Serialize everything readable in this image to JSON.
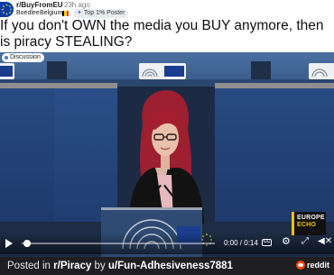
{
  "post": {
    "subreddit": "r/BuyFromEU",
    "time_ago": "· 23h ago",
    "author": "Boedlee",
    "country_flair": "Belgium",
    "badge": "Top 1% Poster",
    "title": "If you don't OWN the media you BUY anymore, then is piracy STEALING?",
    "flair_tag": "Discussion"
  },
  "video": {
    "overlay_brand_line1": "EUROPE",
    "overlay_brand_line2": "ECHO",
    "time_display": "0:00 / 0:14",
    "cc_label": "CC"
  },
  "footer": {
    "prefix": "Posted in ",
    "subreddit": "r/Piracy",
    "by": " by ",
    "user": "u/Fun-Adhesiveness7881",
    "brand": "reddit"
  },
  "colors": {
    "flag_be": [
      "#000000",
      "#f7d117",
      "#ef3340"
    ],
    "badge_bg": "#e9ecef",
    "eu_blue": "#274a82",
    "echo_yellow": "#f2c200",
    "reddit_orange": "#ff4500"
  },
  "icons": [
    "play-icon",
    "closed-captions-icon",
    "gear-icon",
    "expand-icon",
    "mute-icon",
    "reddit-logo"
  ]
}
